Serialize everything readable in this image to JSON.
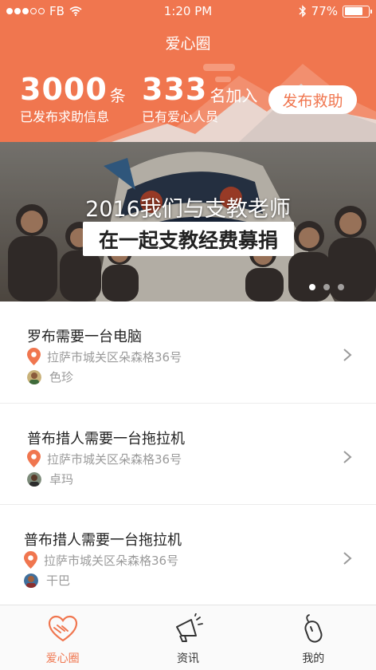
{
  "status_bar": {
    "carrier": "FB",
    "time": "1:20 PM",
    "battery": "77%",
    "battery_level": 0.77
  },
  "header": {
    "title": "爱心圈",
    "stats": [
      {
        "value": "3000",
        "unit": "条",
        "label": "已发布求助信息"
      },
      {
        "value": "333",
        "unit": "名加入",
        "label": "已有爱心人员"
      }
    ],
    "publish_button": "发布救助",
    "accent_color": "#f0764f"
  },
  "banner": {
    "line1": "2016我们与支教老师",
    "line2": "在一起支教经费募捐",
    "pages": 3,
    "active_page": 1
  },
  "list": {
    "items": [
      {
        "title": "罗布需要一台电脑",
        "address": "拉萨市城关区朵森格36号",
        "user": "色珍"
      },
      {
        "title": "普布措人需要一台拖拉机",
        "address": "拉萨市城关区朵森格36号",
        "user": "卓玛"
      },
      {
        "title": "普布措人需要一台拖拉机",
        "address": "拉萨市城关区朵森格36号",
        "user": "干巴"
      }
    ],
    "icons": {
      "address": "location-pin-icon",
      "more": "chevron-right-icon"
    }
  },
  "tabbar": {
    "tabs": [
      {
        "label": "爱心圈",
        "icon": "heart-hands-icon",
        "active": true
      },
      {
        "label": "资讯",
        "icon": "megaphone-icon",
        "active": false
      },
      {
        "label": "我的",
        "icon": "mouse-icon",
        "active": false
      }
    ]
  }
}
